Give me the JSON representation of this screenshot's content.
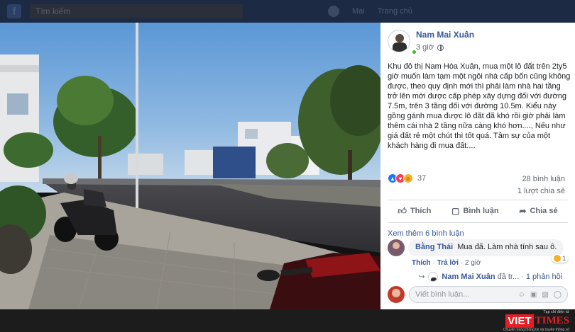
{
  "topbar": {
    "logo": "f",
    "search_placeholder": "Tìm kiếm",
    "nav": [
      "Mai",
      "Trang chủ"
    ]
  },
  "post": {
    "author": "Nam Mai Xuân",
    "time": "3 giờ",
    "privacy_icon": "globe-icon",
    "text": "Khu đô thị Nam Hòa Xuân, mua một lô đất trên 2ty5 giờ muốn làm tạm một ngôi nhà cấp bốn cũng không được, theo quy định mới thì phải làm nhà hai tầng trở lên mới được cấp phép xây dựng đối với đường 7.5m, trên 3 tầng đối với đường 10.5m. Kiểu này gồng gánh mua được lô đất đã khó rồi giờ phải làm thêm cái nhà 2 tầng nữa càng khó hơn...., Nếu như giá đất rẻ một chút thì tốt quá. Tâm sự của một khách hàng đi mua đất....",
    "reaction_count": "37",
    "comments_count": "28 bình luận",
    "shares_count": "1 lượt chia sẻ"
  },
  "actions": {
    "like": "Thích",
    "comment": "Bình luận",
    "share": "Chia sẻ"
  },
  "comments": {
    "see_more": "Xem thêm 6 bình luận",
    "items": [
      {
        "name": "Bằng Thái",
        "text": "Mua đã. Làm nhà tính sau ô.",
        "reaction_count": "1",
        "like_label": "Thích",
        "reply_label": "Trả lời",
        "time": "2 giờ"
      }
    ],
    "reply": {
      "name": "Nam Mai Xuân",
      "snippet": "đã tr...",
      "count": "1 phản hồi"
    },
    "write_placeholder": "Viết bình luận..."
  },
  "watermark": {
    "top": "Tạp chí điện tử",
    "viet": "VIET",
    "times": "TIMES",
    "sub": "Chuyên trang thông tin và truyền thông số"
  },
  "colors": {
    "link_blue": "#385898",
    "like_blue": "#1877f2",
    "online_green": "#42b72a",
    "brand_red": "#e31e24"
  }
}
